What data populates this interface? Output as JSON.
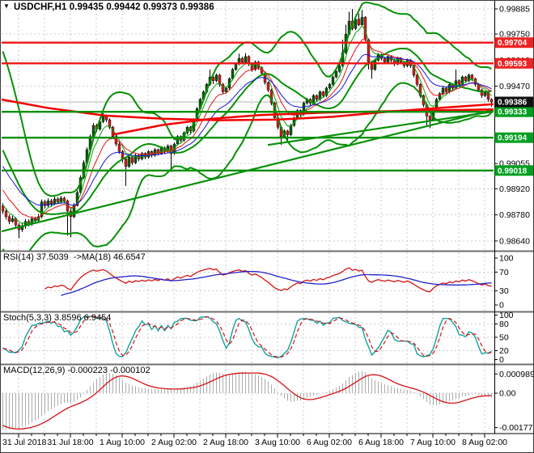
{
  "header": {
    "dropdown_icon": "▼",
    "title": "USDCHF,H1 0.99435 0.99442 0.99373 0.99386"
  },
  "panes": {
    "rsi": {
      "label": "RSI(14) 37.5039  ->MA(18) 46.6547"
    },
    "stoch": {
      "label": "Stoch(5,3,3) 3.8596 6.9454"
    },
    "macd": {
      "label": "MACD(12,26,9) -0.000223 -0.000102"
    }
  },
  "chart_data": {
    "type": "candlestick",
    "symbol": "USDCHF",
    "timeframe": "H1",
    "ohlc_readout": {
      "open": "0.99435",
      "high": "0.99442",
      "low": "0.99373",
      "close": "0.99386"
    },
    "price_ticks": [
      99885,
      99750,
      99610,
      99470,
      99330,
      99195,
      99055,
      98920,
      98780,
      98640
    ],
    "time_labels": [
      "31 Jul 2018",
      "31 Jul 18:00",
      "1 Aug 10:00",
      "2 Aug 02:00",
      "2 Aug 18:00",
      "3 Aug 10:00",
      "6 Aug 02:00",
      "6 Aug 18:00",
      "7 Aug 10:00",
      "8 Aug 02:00"
    ],
    "levels": {
      "resistance": [
        0.99704,
        0.99593
      ],
      "support": [
        0.99333,
        0.99194,
        0.99018
      ],
      "current": 0.99386
    },
    "trendlines": [
      [
        [
          0,
          0.9869
        ],
        [
          610,
          0.99345
        ]
      ],
      [
        [
          330,
          0.99155
        ],
        [
          610,
          0.99335
        ]
      ]
    ],
    "ma_red": [
      [
        [
          0,
          0.994
        ],
        [
          60,
          0.99352
        ],
        [
          130,
          0.99312
        ],
        [
          200,
          0.99296
        ],
        [
          270,
          0.99288
        ],
        [
          340,
          0.99291
        ],
        [
          410,
          0.99306
        ],
        [
          480,
          0.99334
        ],
        [
          550,
          0.99356
        ],
        [
          610,
          0.99374
        ]
      ],
      [
        [
          140,
          0.99212
        ],
        [
          200,
          0.99262
        ],
        [
          260,
          0.99295
        ],
        [
          320,
          0.99315
        ],
        [
          400,
          0.99328
        ],
        [
          500,
          0.99338
        ],
        [
          610,
          0.99346
        ]
      ]
    ],
    "config": {
      "bb_period": 20,
      "bb_dev": 2,
      "ema_periods": [
        5,
        10,
        18
      ],
      "rsi_period": 14,
      "rsi_ma": 18,
      "stoch": [
        5,
        3,
        3
      ],
      "macd": [
        12,
        26,
        9
      ]
    },
    "rsi_axis": [
      100,
      70,
      30,
      0
    ],
    "stoch_axis": [
      100,
      80,
      50,
      20,
      0
    ],
    "macd_axis": [
      {
        "v": 0.000989,
        "label": "0.000989"
      },
      {
        "v": 0,
        "label": "0.00"
      },
      {
        "v": -0.001773,
        "label": "-0.001773"
      }
    ],
    "colors": {
      "up": "#0a5c0a",
      "down": "#cf1d1d",
      "wick": "#000000",
      "bb": "#069006",
      "level_green": "#069006",
      "level_red": "#f01414",
      "ema_fast": "#0aa00a",
      "ema_mid": "#e81414",
      "ema_slow": "#1616d6",
      "ma_red": "#f20000",
      "rsi": "#d41414",
      "rsi_ma": "#2222cc",
      "stoch_k": "#14a0a0",
      "stoch_d": "#d41414",
      "macd_hist": "#ababab",
      "macd_signal": "#d41414",
      "grid": "#cccccc",
      "bid_line": "#b4b4b4",
      "badge_red": "#ee2222",
      "badge_green": "#00a020",
      "badge_black": "#111111"
    },
    "warmup_closes": [
      99560,
      99540,
      99515,
      99490,
      99455,
      99420,
      99375,
      99320,
      99255,
      99190,
      99120,
      99050,
      98990,
      98940,
      98900,
      98870,
      98850,
      98835,
      98820,
      98810
    ],
    "candles": [
      [
        98830,
        98842,
        98786,
        98800
      ],
      [
        98800,
        98815,
        98755,
        98770
      ],
      [
        98770,
        98782,
        98730,
        98745
      ],
      [
        98745,
        98775,
        98738,
        98760
      ],
      [
        98760,
        98768,
        98712,
        98725
      ],
      [
        98725,
        98735,
        98655,
        98700
      ],
      [
        98700,
        98738,
        98688,
        98720
      ],
      [
        98720,
        98758,
        98705,
        98745
      ],
      [
        98745,
        98756,
        98718,
        98730
      ],
      [
        98730,
        98772,
        98722,
        98760
      ],
      [
        98760,
        98770,
        98735,
        98750
      ],
      [
        98750,
        98785,
        98740,
        98770
      ],
      [
        98770,
        98862,
        98762,
        98850
      ],
      [
        98850,
        98860,
        98815,
        98830
      ],
      [
        98830,
        98868,
        98822,
        98855
      ],
      [
        98855,
        98865,
        98825,
        98840
      ],
      [
        98840,
        98878,
        98832,
        98865
      ],
      [
        98865,
        98875,
        98838,
        98850
      ],
      [
        98850,
        98882,
        98840,
        98870
      ],
      [
        98870,
        98878,
        98842,
        98855
      ],
      [
        98855,
        98862,
        98670,
        98800
      ],
      [
        98800,
        98812,
        98660,
        98770
      ],
      [
        98770,
        98842,
        98762,
        98830
      ],
      [
        98830,
        98912,
        98825,
        98900
      ],
      [
        98900,
        98992,
        98895,
        98980
      ],
      [
        98980,
        99072,
        98972,
        99060
      ],
      [
        99060,
        99142,
        99052,
        99130
      ],
      [
        99130,
        99212,
        99122,
        99200
      ],
      [
        99200,
        99272,
        99192,
        99260
      ],
      [
        99260,
        99268,
        99225,
        99240
      ],
      [
        99240,
        99292,
        99232,
        99280
      ],
      [
        99280,
        99325,
        99272,
        99310
      ],
      [
        99310,
        99318,
        99278,
        99290
      ],
      [
        99290,
        99298,
        99240,
        99250
      ],
      [
        99250,
        99258,
        99188,
        99200
      ],
      [
        99200,
        99212,
        99148,
        99160
      ],
      [
        99160,
        99170,
        99108,
        99120
      ],
      [
        99120,
        99128,
        99060,
        99080
      ],
      [
        99080,
        99088,
        98935,
        99040
      ],
      [
        99040,
        99098,
        99032,
        99090
      ],
      [
        99090,
        99096,
        99048,
        99060
      ],
      [
        99060,
        99108,
        99052,
        99100
      ],
      [
        99100,
        99106,
        99068,
        99080
      ],
      [
        99080,
        99118,
        99072,
        99110
      ],
      [
        99110,
        99116,
        99078,
        99090
      ],
      [
        99090,
        99128,
        99082,
        99120
      ],
      [
        99120,
        99126,
        99088,
        99100
      ],
      [
        99100,
        99138,
        99092,
        99130
      ],
      [
        99130,
        99136,
        99098,
        99110
      ],
      [
        99110,
        99148,
        99102,
        99140
      ],
      [
        99140,
        99146,
        99108,
        99120
      ],
      [
        99120,
        99158,
        99112,
        99150
      ],
      [
        99150,
        99156,
        99010,
        99110
      ],
      [
        99110,
        99168,
        99102,
        99160
      ],
      [
        99160,
        99208,
        99152,
        99200
      ],
      [
        99200,
        99206,
        99168,
        99180
      ],
      [
        99180,
        99228,
        99172,
        99220
      ],
      [
        99220,
        99258,
        99212,
        99250
      ],
      [
        99250,
        99256,
        99218,
        99230
      ],
      [
        99230,
        99298,
        99222,
        99290
      ],
      [
        99290,
        99358,
        99282,
        99350
      ],
      [
        99350,
        99408,
        99342,
        99400
      ],
      [
        99400,
        99448,
        99392,
        99440
      ],
      [
        99440,
        99488,
        99432,
        99480
      ],
      [
        99480,
        99560,
        99472,
        99520
      ],
      [
        99520,
        99528,
        99482,
        99500
      ],
      [
        99500,
        99538,
        99492,
        99530
      ],
      [
        99530,
        99536,
        99468,
        99480
      ],
      [
        99480,
        99488,
        99428,
        99440
      ],
      [
        99440,
        99468,
        99432,
        99460
      ],
      [
        99460,
        99518,
        99452,
        99510
      ],
      [
        99510,
        99568,
        99502,
        99560
      ],
      [
        99560,
        99598,
        99552,
        99590
      ],
      [
        99590,
        99645,
        99582,
        99620
      ],
      [
        99620,
        99628,
        99588,
        99600
      ],
      [
        99600,
        99648,
        99592,
        99630
      ],
      [
        99630,
        99636,
        99578,
        99590
      ],
      [
        99590,
        99596,
        99548,
        99560
      ],
      [
        99560,
        99608,
        99552,
        99600
      ],
      [
        99600,
        99606,
        99558,
        99570
      ],
      [
        99570,
        99576,
        99528,
        99540
      ],
      [
        99540,
        99546,
        99478,
        99490
      ],
      [
        99490,
        99496,
        99438,
        99450
      ],
      [
        99450,
        99456,
        99368,
        99380
      ],
      [
        99380,
        99386,
        99288,
        99300
      ],
      [
        99300,
        99308,
        99238,
        99250
      ],
      [
        99250,
        99258,
        99155,
        99200
      ],
      [
        99200,
        99238,
        99192,
        99230
      ],
      [
        99230,
        99236,
        99170,
        99210
      ],
      [
        99210,
        99268,
        99202,
        99260
      ],
      [
        99260,
        99308,
        99252,
        99300
      ],
      [
        99300,
        99348,
        99292,
        99340
      ],
      [
        99340,
        99346,
        99308,
        99320
      ],
      [
        99320,
        99388,
        99312,
        99380
      ],
      [
        99380,
        99408,
        99372,
        99400
      ],
      [
        99400,
        99406,
        99368,
        99380
      ],
      [
        99380,
        99428,
        99372,
        99420
      ],
      [
        99420,
        99426,
        99388,
        99400
      ],
      [
        99400,
        99448,
        99392,
        99440
      ],
      [
        99440,
        99446,
        99408,
        99420
      ],
      [
        99420,
        99468,
        99412,
        99460
      ],
      [
        99460,
        99488,
        99452,
        99480
      ],
      [
        99480,
        99528,
        99472,
        99520
      ],
      [
        99520,
        99558,
        99512,
        99550
      ],
      [
        99550,
        99588,
        99542,
        99580
      ],
      [
        99580,
        99720,
        99572,
        99650
      ],
      [
        99650,
        99800,
        99642,
        99750
      ],
      [
        99750,
        99870,
        99742,
        99820
      ],
      [
        99820,
        99885,
        99770,
        99780
      ],
      [
        99780,
        99848,
        99772,
        99830
      ],
      [
        99830,
        99860,
        99792,
        99800
      ],
      [
        99800,
        99880,
        99792,
        99840
      ],
      [
        99840,
        99846,
        99712,
        99720
      ],
      [
        99720,
        99726,
        99560,
        99600
      ],
      [
        99600,
        99606,
        99510,
        99560
      ],
      [
        99560,
        99618,
        99552,
        99610
      ],
      [
        99610,
        99648,
        99602,
        99640
      ],
      [
        99640,
        99646,
        99608,
        99620
      ],
      [
        99620,
        99626,
        99588,
        99600
      ],
      [
        99600,
        99638,
        99592,
        99630
      ],
      [
        99630,
        99636,
        99598,
        99610
      ],
      [
        99610,
        99616,
        99578,
        99590
      ],
      [
        99590,
        99628,
        99582,
        99620
      ],
      [
        99620,
        99626,
        99588,
        99600
      ],
      [
        99600,
        99606,
        99568,
        99580
      ],
      [
        99580,
        99618,
        99572,
        99610
      ],
      [
        99610,
        99616,
        99568,
        99580
      ],
      [
        99580,
        99586,
        99518,
        99530
      ],
      [
        99530,
        99536,
        99468,
        99480
      ],
      [
        99480,
        99486,
        99408,
        99420
      ],
      [
        99420,
        99426,
        99358,
        99370
      ],
      [
        99370,
        99376,
        99260,
        99310
      ],
      [
        99310,
        99316,
        99245,
        99290
      ],
      [
        99290,
        99358,
        99282,
        99350
      ],
      [
        99350,
        99408,
        99342,
        99400
      ],
      [
        99400,
        99438,
        99392,
        99430
      ],
      [
        99430,
        99468,
        99422,
        99460
      ],
      [
        99460,
        99466,
        99428,
        99440
      ],
      [
        99440,
        99488,
        99432,
        99480
      ],
      [
        99480,
        99486,
        99448,
        99460
      ],
      [
        99460,
        99560,
        99452,
        99500
      ],
      [
        99500,
        99506,
        99468,
        99480
      ],
      [
        99480,
        99528,
        99472,
        99520
      ],
      [
        99520,
        99526,
        99488,
        99500
      ],
      [
        99500,
        99538,
        99492,
        99530
      ],
      [
        99530,
        99536,
        99498,
        99510
      ],
      [
        99510,
        99516,
        99468,
        99480
      ],
      [
        99480,
        99486,
        99438,
        99450
      ],
      [
        99450,
        99456,
        99408,
        99420
      ],
      [
        99420,
        99446,
        99412,
        99440
      ],
      [
        99440,
        99446,
        99388,
        99400
      ],
      [
        99400,
        99406,
        99360,
        99386
      ]
    ]
  }
}
